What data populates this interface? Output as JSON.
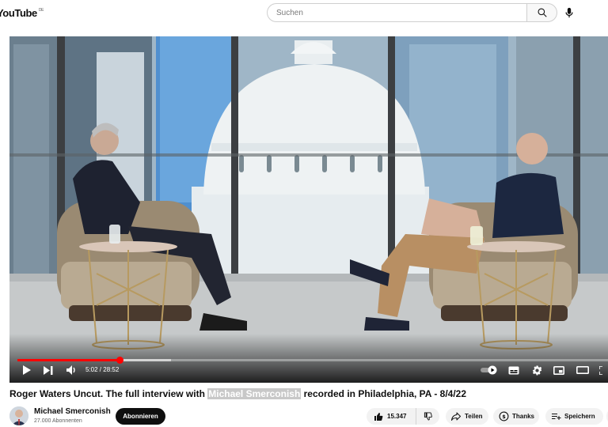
{
  "header": {
    "logo_text": "YouTube",
    "region_code": "DE",
    "search_placeholder": "Suchen",
    "icons": {
      "search": "search-icon",
      "voice": "microphone-icon"
    }
  },
  "player": {
    "current_time": "5:02",
    "duration": "28:52",
    "time_separator": " / ",
    "progress_fraction": 0.174,
    "buffer_fraction": 0.26,
    "controls": [
      "play-icon",
      "next-icon",
      "volume-icon",
      "autoplay-toggle-icon",
      "subtitles-icon",
      "settings-gear-icon",
      "miniplayer-icon",
      "theater-mode-icon",
      "fullscreen-icon"
    ]
  },
  "video": {
    "title_before": "Roger Waters Uncut. The full interview with ",
    "title_highlight": "Michael Smerconish",
    "title_after": " recorded in Philadelphia, PA - 8/4/22"
  },
  "channel": {
    "name": "Michael Smerconish",
    "subscribers": "27.000 Abonnenten",
    "subscribe_label": "Abonnieren"
  },
  "actions": {
    "like_count": "15.347",
    "share_label": "Teilen",
    "thanks_label": "Thanks",
    "save_label": "Speichern"
  },
  "colors": {
    "accent": "#ff0000",
    "text": "#0f0f0f",
    "secondary_text": "#606060",
    "pill_bg": "#f2f2f2"
  }
}
